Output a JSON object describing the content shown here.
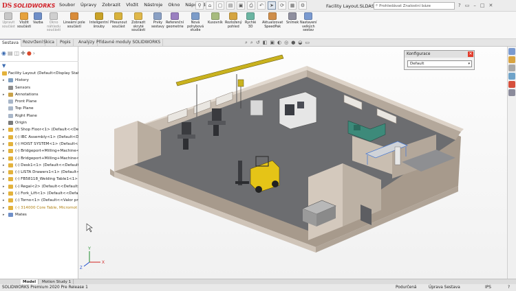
{
  "app": {
    "logo_ds": "DS",
    "logo_text": "SOLIDWORKS",
    "title": "Facility Layout.SLDASM *"
  },
  "menus": [
    "Soubor",
    "Úpravy",
    "Zobrazit",
    "Vložit",
    "Nástroje",
    "Okno",
    "Nápověda"
  ],
  "search": {
    "placeholder": "Prohledávat Znalostní báze"
  },
  "ribbon": [
    {
      "name": "upravit-soucast",
      "l1": "Upravit",
      "l2": "součást",
      "l3": "",
      "disabled": true,
      "color": "#c8c8c8"
    },
    {
      "name": "vlozit-soucasti",
      "l1": "Vložit",
      "l2": "součásti",
      "l3": "",
      "disabled": false,
      "color": "#e6a23c"
    },
    {
      "name": "vazba",
      "l1": "Vazba",
      "l2": "",
      "l3": "",
      "disabled": false,
      "color": "#6f8fc8"
    },
    {
      "name": "okno-nahledu",
      "l1": "Okno",
      "l2": "náhledu",
      "l3": "součásti",
      "disabled": true,
      "color": "#cfcfcf"
    },
    {
      "name": "linearni-pole",
      "l1": "Lineární pole",
      "l2": "součástí",
      "l3": "",
      "disabled": false,
      "color": "#d98c3a"
    },
    {
      "name": "inteligentni-srouby",
      "l1": "Inteligentní",
      "l2": "šrouby",
      "l3": "",
      "disabled": false,
      "color": "#c9a227"
    },
    {
      "name": "presunout-soucast",
      "l1": "Přesunout",
      "l2": "součást",
      "l3": "",
      "disabled": false,
      "color": "#d8b23c"
    },
    {
      "name": "zobrazit-skryte",
      "l1": "Zobrazit",
      "l2": "skryté",
      "l3": "součásti",
      "disabled": false,
      "color": "#e0b84a"
    },
    {
      "name": "prvky-sestavy",
      "l1": "Prvky",
      "l2": "sestavy",
      "l3": "",
      "disabled": false,
      "color": "#8aa0c4"
    },
    {
      "name": "referencni-geometrie",
      "l1": "Referenční",
      "l2": "geometrie",
      "l3": "",
      "disabled": false,
      "color": "#9a7fc0"
    },
    {
      "name": "nova-pohybova-studie",
      "l1": "Nová",
      "l2": "pohybová",
      "l3": "studie",
      "disabled": false,
      "color": "#7c9cc9"
    },
    {
      "name": "kusovnik",
      "l1": "Kusovník",
      "l2": "",
      "l3": "",
      "disabled": false,
      "color": "#a7bb7e"
    },
    {
      "name": "rozlozeny-pohled",
      "l1": "Rozložený",
      "l2": "pohled",
      "l3": "",
      "disabled": false,
      "color": "#d5a541"
    },
    {
      "name": "rychle-3d",
      "l1": "Rychlé",
      "l2": "3D",
      "l3": "",
      "disabled": false,
      "color": "#6bb5a2"
    },
    {
      "name": "aktualizovat-speedpak",
      "l1": "Aktualizovat",
      "l2": "SpeedPak",
      "l3": "",
      "disabled": false,
      "color": "#cf8e4a"
    },
    {
      "name": "snimek",
      "l1": "Snímek",
      "l2": "",
      "l3": "",
      "disabled": false,
      "color": "#8f8f9f"
    },
    {
      "name": "nastaveni-velkych-sestav",
      "l1": "Nastavení",
      "l2": "velkých",
      "l3": "sestav",
      "disabled": false,
      "color": "#7a9ad0"
    }
  ],
  "tabs": [
    "Sestava",
    "Rozvržení",
    "Skica",
    "Popis",
    "Analýzy",
    "Přídavné moduly SOLIDWORKS"
  ],
  "tree": [
    {
      "label": "Facility Layout  (Default<Display State-1>)",
      "indent": 0,
      "exp": "",
      "color": "#e3b23c",
      "highlight": false
    },
    {
      "label": "History",
      "indent": 1,
      "exp": "▸",
      "color": "#7f9fc0",
      "highlight": false
    },
    {
      "label": "Sensors",
      "indent": 1,
      "exp": "",
      "color": "#8d8d8d",
      "highlight": false
    },
    {
      "label": "Annotations",
      "indent": 1,
      "exp": "▸",
      "color": "#c9a24a",
      "highlight": false
    },
    {
      "label": "Front Plane",
      "indent": 1,
      "exp": "",
      "color": "#a9b7c9",
      "highlight": false
    },
    {
      "label": "Top Plane",
      "indent": 1,
      "exp": "",
      "color": "#a9b7c9",
      "highlight": false
    },
    {
      "label": "Right Plane",
      "indent": 1,
      "exp": "",
      "color": "#a9b7c9",
      "highlight": false
    },
    {
      "label": "Origin",
      "indent": 1,
      "exp": "",
      "color": "#7a7a7a",
      "highlight": false
    },
    {
      "label": "(f) Shop Floor<1> (Default<<Default>_Disp",
      "indent": 1,
      "exp": "▸",
      "color": "#e3b23c",
      "highlight": false
    },
    {
      "label": "(-) IBC Assembly<1> (Default<Display State-",
      "indent": 1,
      "exp": "▸",
      "color": "#e3b23c",
      "highlight": false
    },
    {
      "label": "(-) HOIST SYSTEM<1> (Default<Display State",
      "indent": 1,
      "exp": "▸",
      "color": "#e3b23c",
      "highlight": false
    },
    {
      "label": "(-) Bridgeport+Milling+Machine<1> (Default<<",
      "indent": 1,
      "exp": "▸",
      "color": "#e3b23c",
      "highlight": false
    },
    {
      "label": "(-) Bridgeport+Milling+Machine<2> (Default<<",
      "indent": 1,
      "exp": "▸",
      "color": "#e3b23c",
      "highlight": false
    },
    {
      "label": "(-) Desk1<1> (Default<<Default>_Display Sta",
      "indent": 1,
      "exp": "▸",
      "color": "#e3b23c",
      "highlight": false
    },
    {
      "label": "(-) LISTA Drawers1<1> (Default<Display Sta",
      "indent": 1,
      "exp": "▸",
      "color": "#e3b23c",
      "highlight": false
    },
    {
      "label": "(-) FB58118_Welding Table1<1> (Default<<De",
      "indent": 1,
      "exp": "▸",
      "color": "#e3b23c",
      "highlight": false
    },
    {
      "label": "(-) Regal<2> (Default<<Default>_Display Stat",
      "indent": 1,
      "exp": "▸",
      "color": "#e3b23c",
      "highlight": false
    },
    {
      "label": "(-) Fork_Lift<1> (Default<<Default>_Display",
      "indent": 1,
      "exp": "▸",
      "color": "#e3b23c",
      "highlight": false
    },
    {
      "label": "(-) Torno<1> (Default<<Valor predeterminado>",
      "indent": 1,
      "exp": "▸",
      "color": "#e3b23c",
      "highlight": false
    },
    {
      "label": "(-) 314000 Core Table, Micromot Grid Plate",
      "indent": 1,
      "exp": "▸",
      "color": "#e3b23c",
      "highlight": true
    },
    {
      "label": "Mates",
      "indent": 1,
      "exp": "▸",
      "color": "#6f8fc8",
      "highlight": false
    }
  ],
  "config_panel": {
    "title": "Konfigurace",
    "value": "Default"
  },
  "bottom_tabs": [
    "Model",
    "Motion Study 1"
  ],
  "status": {
    "product": "SOLIDWORKS Premium 2020 Pre Release 1",
    "state": "Podurčená",
    "mode": "Úprava Sestava",
    "units": "IPS"
  }
}
